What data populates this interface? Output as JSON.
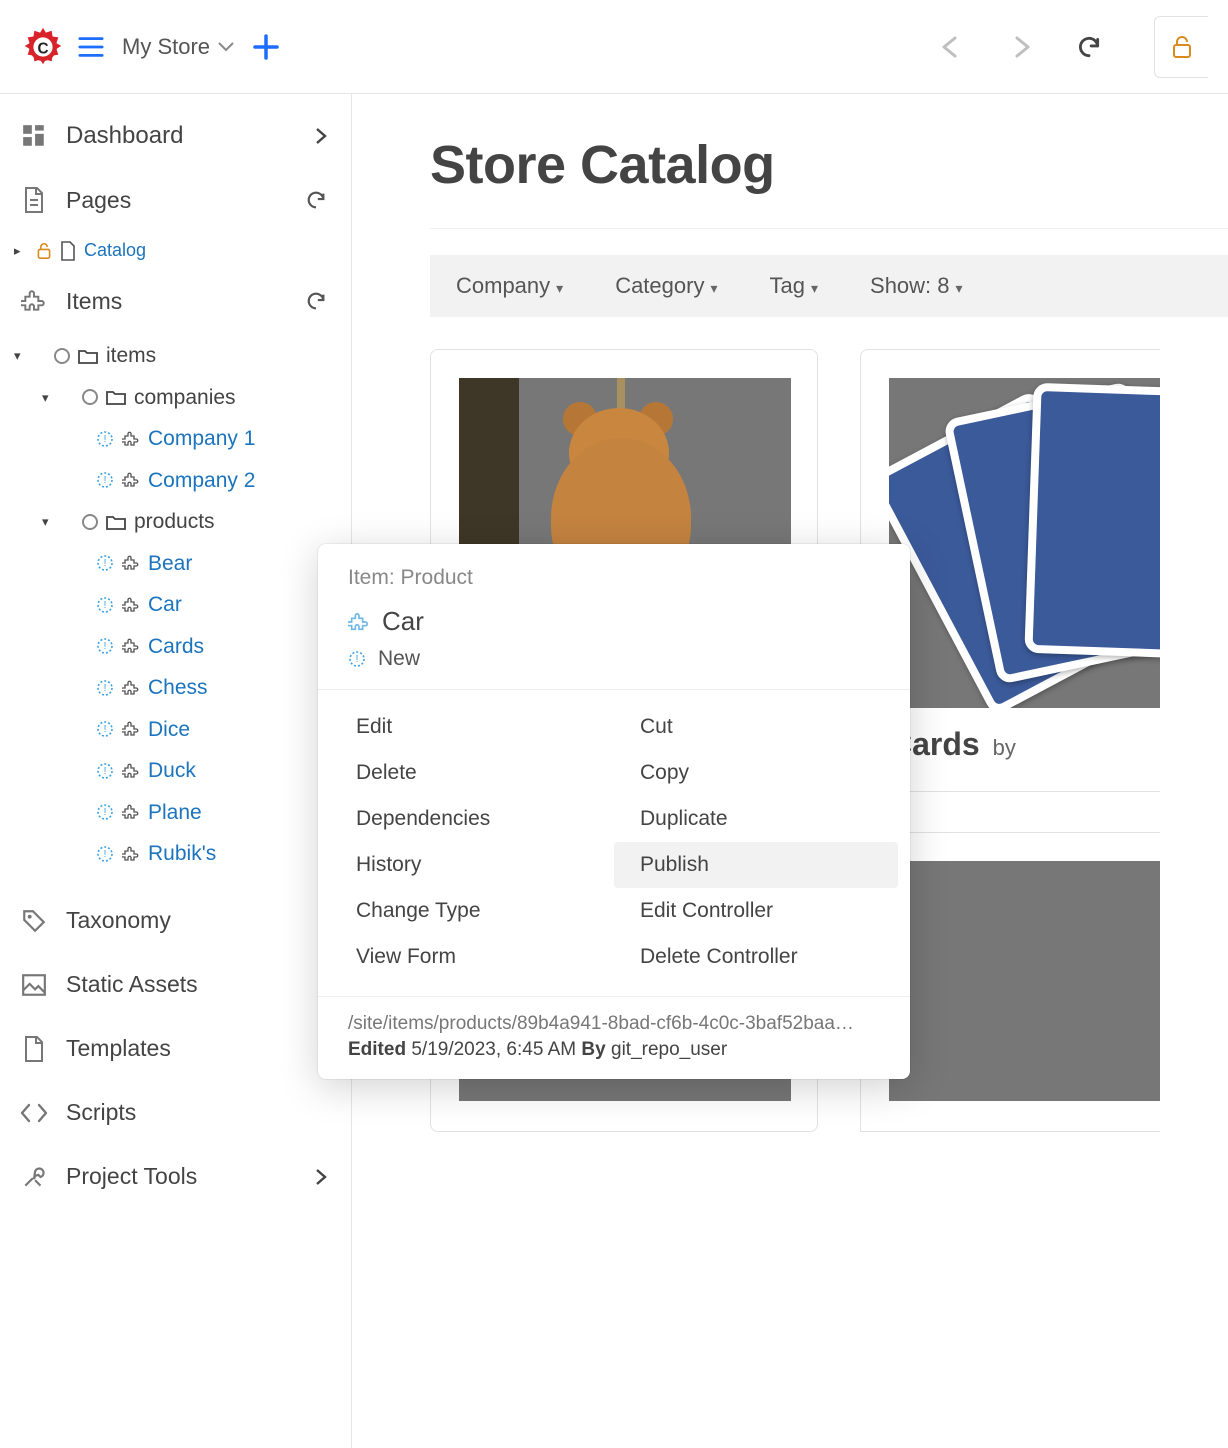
{
  "header": {
    "store_name": "My Store"
  },
  "sidebar": {
    "dashboard": "Dashboard",
    "pages": "Pages",
    "catalog_page": "Catalog",
    "items": "Items",
    "taxonomy": "Taxonomy",
    "static_assets": "Static Assets",
    "templates": "Templates",
    "scripts": "Scripts",
    "project_tools": "Project Tools",
    "tree": {
      "root": "items",
      "companies": "companies",
      "company_list": [
        "Company 1",
        "Company 2"
      ],
      "products": "products",
      "product_list": [
        "Bear",
        "Car",
        "Cards",
        "Chess",
        "Dice",
        "Duck",
        "Plane",
        "Rubik's"
      ]
    }
  },
  "main": {
    "title": "Store Catalog",
    "filters": {
      "company": "Company",
      "category": "Category",
      "tag": "Tag",
      "show": "Show: 8"
    },
    "cards": {
      "card2_title": "Cards",
      "by": "by"
    }
  },
  "context_menu": {
    "type_line": "Item: Product",
    "name": "Car",
    "status": "New",
    "left": [
      "Edit",
      "Delete",
      "Dependencies",
      "History",
      "Change Type",
      "View Form"
    ],
    "right": [
      "Cut",
      "Copy",
      "Duplicate",
      "Publish",
      "Edit Controller",
      "Delete Controller"
    ],
    "hover_index_right": 3,
    "path": "/site/items/products/89b4a941-8bad-cf6b-4c0c-3baf52baa…",
    "edited_label": "Edited",
    "edited_time": "5/19/2023, 6:45 AM",
    "by_label": "By",
    "edited_by": "git_repo_user"
  }
}
